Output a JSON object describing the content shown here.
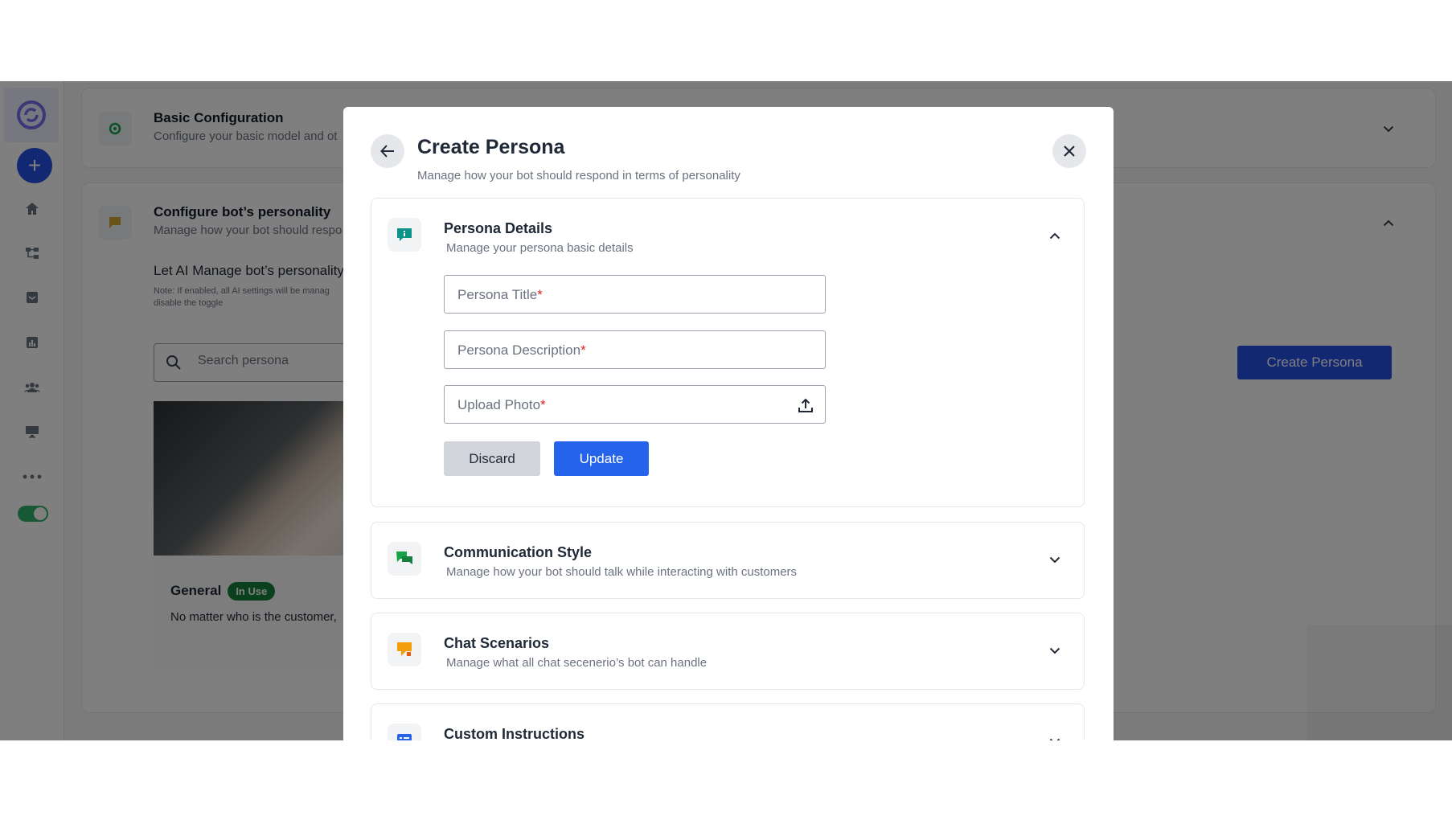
{
  "background": {
    "basic_config": {
      "title": "Basic Configuration",
      "subtitle": "Configure your basic model and ot"
    },
    "personality": {
      "title": "Configure bot’s personality",
      "subtitle": "Manage how your bot should respo",
      "ai_manage_label": "Let AI Manage bot’s personality",
      "note_line1": "Note: If enabled, all AI settings will be manag",
      "note_line2": "disable the toggle",
      "search_placeholder": "Search persona",
      "persona_name": "General",
      "persona_badge": "In Use",
      "persona_desc": "No matter who is the customer,",
      "create_button": "Create Persona"
    }
  },
  "modal": {
    "title": "Create Persona",
    "subtitle": "Manage how your bot should respond in terms of personality",
    "sections": [
      {
        "title": "Persona Details",
        "subtitle": "Manage your persona basic details",
        "icon": "info-icon",
        "expanded": true
      },
      {
        "title": "Communication Style",
        "subtitle": "Manage how your bot should talk while interacting with customers",
        "icon": "chat-bubbles-icon",
        "expanded": false
      },
      {
        "title": "Chat Scenarios",
        "subtitle": "Manage what all chat secenerio’s bot can handle",
        "icon": "scenario-chat-icon",
        "expanded": false
      },
      {
        "title": "Custom Instructions",
        "subtitle": "",
        "icon": "list-icon",
        "expanded": false
      }
    ],
    "fields": {
      "title_placeholder": "Persona Title",
      "description_placeholder": "Persona Description",
      "upload_placeholder": "Upload Photo",
      "required_marker": "*"
    },
    "buttons": {
      "discard": "Discard",
      "update": "Update"
    }
  },
  "colors": {
    "primary": "#2451e6",
    "update": "#2563eb",
    "in_use": "#15803d",
    "required": "#dc2626"
  }
}
